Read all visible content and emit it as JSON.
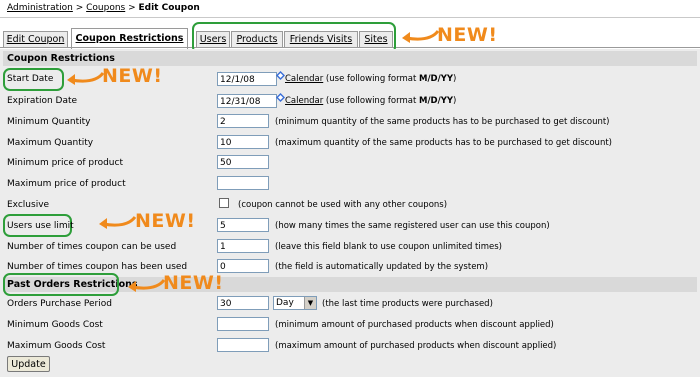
{
  "breadcrumb": {
    "administration": "Administration",
    "sep1": " > ",
    "coupons": "Coupons",
    "sep2": " > ",
    "current": "Edit Coupon"
  },
  "tabs": [
    {
      "label": "Edit Coupon"
    },
    {
      "label": "Coupon Restrictions"
    },
    {
      "label": "Users"
    },
    {
      "label": "Products"
    },
    {
      "label": "Friends Visits"
    },
    {
      "label": "Sites"
    }
  ],
  "annotations": {
    "new": "NEW!",
    "accent_color": "#f08a1c",
    "highlight_color": "#2e9e3a"
  },
  "coupon_restrictions": {
    "heading": "Coupon Restrictions",
    "start_date": {
      "label": "Start Date",
      "value": "12/1/08",
      "calendar": "Calendar",
      "hint": " (use following format ",
      "format": "M/D/YY",
      "close": ")"
    },
    "expiration_date": {
      "label": "Expiration Date",
      "value": "12/31/08",
      "calendar": "Calendar",
      "hint": " (use following format ",
      "format": "M/D/YY",
      "close": ")"
    },
    "min_quantity": {
      "label": "Minimum Quantity",
      "value": "2",
      "hint": "(minimum quantity of the same products has to be purchased to get discount)"
    },
    "max_quantity": {
      "label": "Maximum Quantity",
      "value": "10",
      "hint": "(maximum quantity of the same products has to be purchased to get discount)"
    },
    "min_price": {
      "label": "Minimum price of product",
      "value": "50"
    },
    "max_price": {
      "label": "Maximum price of product",
      "value": ""
    },
    "exclusive": {
      "label": "Exclusive",
      "checked": false,
      "hint": "(coupon cannot be used with any other coupons)"
    },
    "users_use_limit": {
      "label": "Users use limit",
      "value": "5",
      "hint": "(how many times the same registered user can use this coupon)"
    },
    "times_can_be_used": {
      "label": "Number of times coupon can be used",
      "value": "1",
      "hint": "(leave this field blank to use coupon unlimited times)"
    },
    "times_has_been_used": {
      "label": "Number of times coupon has been used",
      "value": "0",
      "hint": "(the field is automatically updated by the system)"
    }
  },
  "past_orders": {
    "heading": "Past Orders Restrictions",
    "purchase_period": {
      "label": "Orders Purchase Period",
      "value": "30",
      "unit": "Day",
      "hint": "(the last time products were purchased)"
    },
    "min_goods_cost": {
      "label": "Minimum Goods Cost",
      "value": "",
      "hint": "(minimum amount of purchased products when discount applied)"
    },
    "max_goods_cost": {
      "label": "Maximum Goods Cost",
      "value": "",
      "hint": "(maximum amount of purchased products when discount applied)"
    }
  },
  "update_button": "Update"
}
